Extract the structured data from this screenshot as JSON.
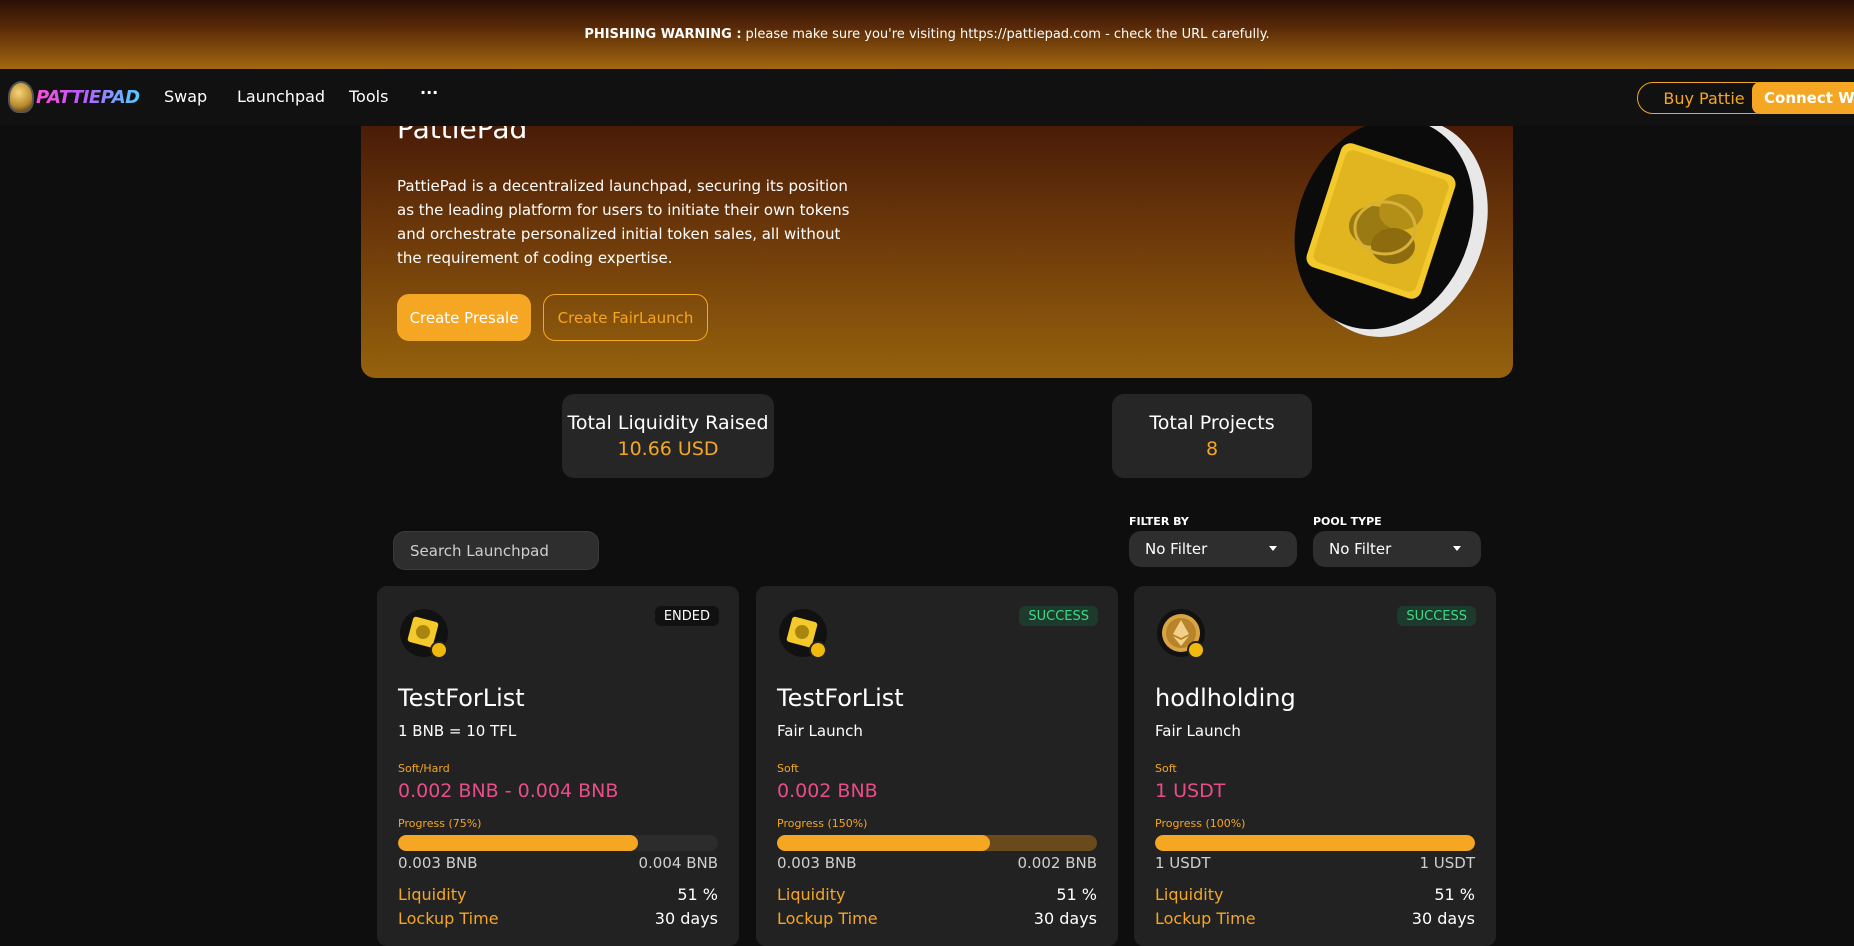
{
  "warning": {
    "title": "PHISHING WARNING :",
    "text": "please make sure you're visiting https://pattiepad.com - check the URL carefully."
  },
  "nav": {
    "logo_text": "PATTIEPAD",
    "links": [
      "Swap",
      "Launchpad",
      "Tools",
      "···"
    ],
    "buy_label": "Buy Pattie",
    "connect_label": "Connect Wallet"
  },
  "hero": {
    "title": "PattiePad",
    "description": "PattiePad is a decentralized launchpad, securing its position as the leading platform for users to initiate their own tokens and orchestrate personalized initial token sales, all without the requirement of coding expertise.",
    "create_presale": "Create Presale",
    "create_fairlaunch": "Create FairLaunch"
  },
  "stats": {
    "liquidity_label": "Total Liquidity Raised",
    "liquidity_value": "10.66 USD",
    "projects_label": "Total Projects",
    "projects_value": "8"
  },
  "filters": {
    "search_placeholder": "Search Launchpad",
    "filter_by_label": "FILTER BY",
    "filter_by_value": "No Filter",
    "pool_type_label": "POOL TYPE",
    "pool_type_value": "No Filter"
  },
  "cards": [
    {
      "status": "ENDED",
      "title": "TestForList",
      "subtitle": "1 BNB = 10 TFL",
      "cap_label": "Soft/Hard",
      "cap_value": "0.002 BNB - 0.004 BNB",
      "progress_label": "Progress (75%)",
      "progress": 0.75,
      "min": "0.003 BNB",
      "max": "0.004 BNB",
      "liquidity_label": "Liquidity",
      "liquidity": "51 %",
      "lockup_label": "Lockup Time",
      "lockup": "30 days",
      "logo": "pattie-gold-icon"
    },
    {
      "status": "SUCCESS",
      "title": "TestForList",
      "subtitle": "Fair Launch",
      "cap_label": "Soft",
      "cap_value": "0.002 BNB",
      "progress_label": "Progress (150%)",
      "progress": 0.666,
      "min": "0.003 BNB",
      "max": "0.002 BNB",
      "liquidity_label": "Liquidity",
      "liquidity": "51 %",
      "lockup_label": "Lockup Time",
      "lockup": "30 days",
      "logo": "pattie-gold-icon"
    },
    {
      "status": "SUCCESS",
      "title": "hodlholding",
      "subtitle": "Fair Launch",
      "cap_label": "Soft",
      "cap_value": "1 USDT",
      "progress_label": "Progress (100%)",
      "progress": 1.0,
      "min": "1 USDT",
      "max": "1 USDT",
      "liquidity_label": "Liquidity",
      "liquidity": "51 %",
      "lockup_label": "Lockup Time",
      "lockup": "30 days",
      "logo": "ethereum-coin-icon"
    }
  ],
  "colors": {
    "accent": "#f5a623",
    "cap_value": "#ea4c89",
    "success": "#3ddc84"
  }
}
